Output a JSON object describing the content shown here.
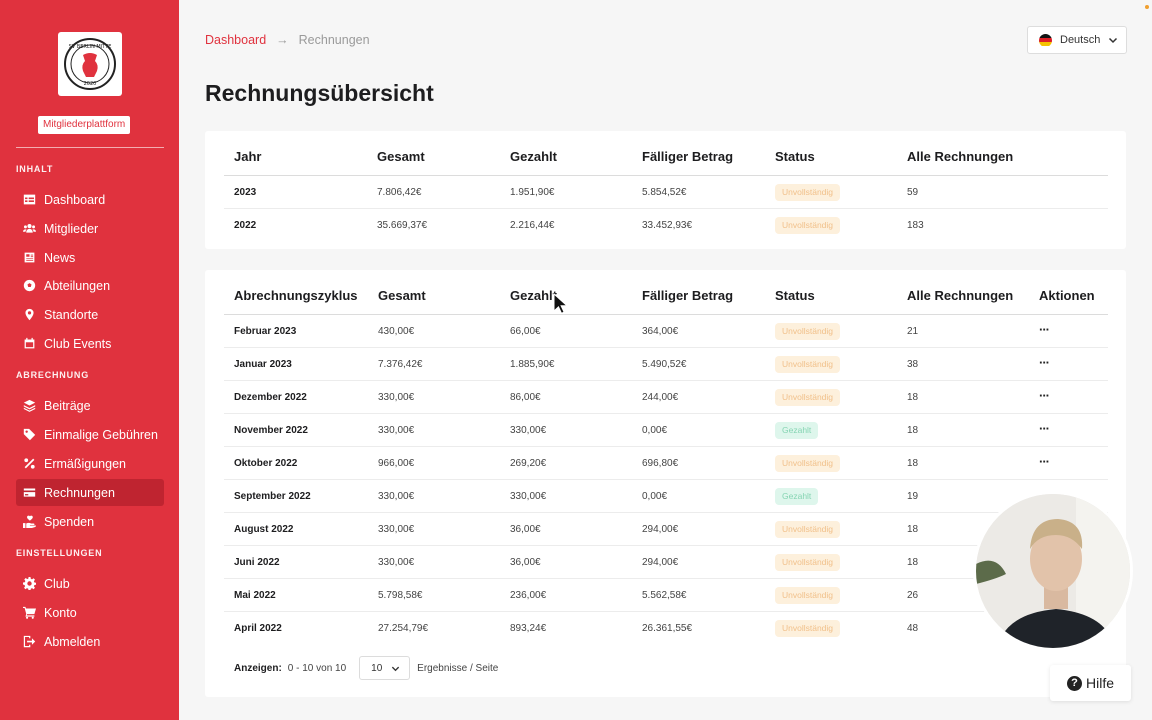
{
  "sidebar": {
    "platform_badge": "Mitgliederplattform",
    "sections": [
      {
        "label": "INHALT",
        "items": [
          {
            "label": "Dashboard",
            "icon": "table-icon"
          },
          {
            "label": "Mitglieder",
            "icon": "users-icon"
          },
          {
            "label": "News",
            "icon": "newspaper-icon"
          },
          {
            "label": "Abteilungen",
            "icon": "soccer-ball-icon"
          },
          {
            "label": "Standorte",
            "icon": "map-pin-icon"
          },
          {
            "label": "Club Events",
            "icon": "calendar-icon"
          }
        ]
      },
      {
        "label": "ABRECHNUNG",
        "items": [
          {
            "label": "Beiträge",
            "icon": "layers-icon"
          },
          {
            "label": "Einmalige Gebühren",
            "icon": "tag-icon"
          },
          {
            "label": "Ermäßigungen",
            "icon": "percent-icon"
          },
          {
            "label": "Rechnungen",
            "icon": "credit-card-icon",
            "active": true
          },
          {
            "label": "Spenden",
            "icon": "hand-heart-icon"
          }
        ]
      },
      {
        "label": "EINSTELLUNGEN",
        "items": [
          {
            "label": "Club",
            "icon": "gear-icon"
          },
          {
            "label": "Konto",
            "icon": "cart-icon"
          },
          {
            "label": "Abmelden",
            "icon": "logout-icon"
          }
        ]
      }
    ]
  },
  "breadcrumb": {
    "link": "Dashboard",
    "arrow": "→",
    "current": "Rechnungen"
  },
  "language": {
    "label": "Deutsch",
    "flag": "de-flag-icon"
  },
  "page_title": "Rechnungsübersicht",
  "yearly_table": {
    "headers": [
      "Jahr",
      "Gesamt",
      "Gezahlt",
      "Fälliger Betrag",
      "Status",
      "Alle Rechnungen"
    ],
    "rows": [
      {
        "year": "2023",
        "total": "7.806,42€",
        "paid": "1.951,90€",
        "due": "5.854,52€",
        "status": "Unvollständig",
        "status_type": "warn",
        "count": "59"
      },
      {
        "year": "2022",
        "total": "35.669,37€",
        "paid": "2.216,44€",
        "due": "33.452,93€",
        "status": "Unvollständig",
        "status_type": "warn",
        "count": "183"
      }
    ]
  },
  "cycle_table": {
    "headers": [
      "Abrechnungszyklus",
      "Gesamt",
      "Gezahlt",
      "Fälliger Betrag",
      "Status",
      "Alle Rechnungen",
      "Aktionen"
    ],
    "rows": [
      {
        "cycle": "Februar 2023",
        "total": "430,00€",
        "paid": "66,00€",
        "due": "364,00€",
        "status": "Unvollständig",
        "status_type": "warn",
        "count": "21",
        "actions": "···"
      },
      {
        "cycle": "Januar 2023",
        "total": "7.376,42€",
        "paid": "1.885,90€",
        "due": "5.490,52€",
        "status": "Unvollständig",
        "status_type": "warn",
        "count": "38",
        "actions": "···"
      },
      {
        "cycle": "Dezember 2022",
        "total": "330,00€",
        "paid": "86,00€",
        "due": "244,00€",
        "status": "Unvollständig",
        "status_type": "warn",
        "count": "18",
        "actions": "···"
      },
      {
        "cycle": "November 2022",
        "total": "330,00€",
        "paid": "330,00€",
        "due": "0,00€",
        "status": "Gezahlt",
        "status_type": "ok",
        "count": "18",
        "actions": "···"
      },
      {
        "cycle": "Oktober 2022",
        "total": "966,00€",
        "paid": "269,20€",
        "due": "696,80€",
        "status": "Unvollständig",
        "status_type": "warn",
        "count": "18",
        "actions": "···"
      },
      {
        "cycle": "September 2022",
        "total": "330,00€",
        "paid": "330,00€",
        "due": "0,00€",
        "status": "Gezahlt",
        "status_type": "ok",
        "count": "19",
        "actions": ""
      },
      {
        "cycle": "August 2022",
        "total": "330,00€",
        "paid": "36,00€",
        "due": "294,00€",
        "status": "Unvollständig",
        "status_type": "warn",
        "count": "18",
        "actions": ""
      },
      {
        "cycle": "Juni 2022",
        "total": "330,00€",
        "paid": "36,00€",
        "due": "294,00€",
        "status": "Unvollständig",
        "status_type": "warn",
        "count": "18",
        "actions": ""
      },
      {
        "cycle": "Mai 2022",
        "total": "5.798,58€",
        "paid": "236,00€",
        "due": "5.562,58€",
        "status": "Unvollständig",
        "status_type": "warn",
        "count": "26",
        "actions": ""
      },
      {
        "cycle": "April 2022",
        "total": "27.254,79€",
        "paid": "893,24€",
        "due": "26.361,55€",
        "status": "Unvollständig",
        "status_type": "warn",
        "count": "48",
        "actions": ""
      }
    ]
  },
  "pagination": {
    "label": "Anzeigen:",
    "range": "0 - 10 von 10",
    "per_page": "10",
    "suffix": "Ergebnisse / Seite"
  },
  "help_button": "Hilfe",
  "colors": {
    "brand": "#e0323e",
    "status_warn_bg": "#fdf0dc",
    "status_ok_bg": "#def6ec"
  }
}
